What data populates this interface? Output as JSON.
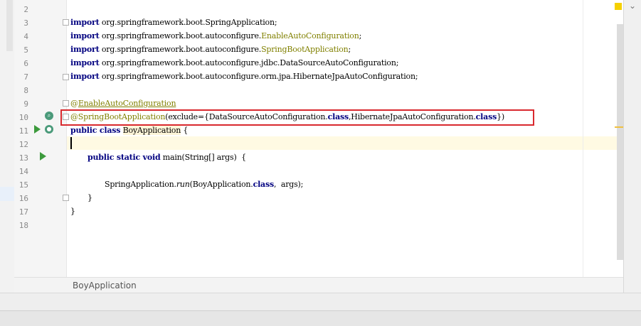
{
  "editor": {
    "line_numbers": [
      "2",
      "3",
      "4",
      "5",
      "6",
      "7",
      "8",
      "9",
      "10",
      "11",
      "12",
      "13",
      "14",
      "15",
      "16",
      "17",
      "18"
    ],
    "code": {
      "l3": [
        "import",
        " org.springframework.boot.SpringApplication;"
      ],
      "l4": [
        "import",
        " org.springframework.boot.autoconfigure.",
        "EnableAutoConfiguration",
        ";"
      ],
      "l5": [
        "import",
        " org.springframework.boot.autoconfigure.",
        "SpringBootApplication",
        ";"
      ],
      "l6": [
        "import",
        " org.springframework.boot.autoconfigure.jdbc.DataSourceAutoConfiguration;"
      ],
      "l7": [
        "import",
        " org.springframework.boot.autoconfigure.orm.jpa.HibernateJpaAutoConfiguration;"
      ],
      "l9": [
        "@",
        "EnableAutoConfiguration"
      ],
      "l10": [
        "@SpringBootApplication",
        "(exclude={DataSourceAutoConfiguration.",
        "class",
        ",HibernateJpaAutoConfiguration.",
        "class",
        "})"
      ],
      "l11": [
        "public class",
        " ",
        "BoyApplication",
        " {"
      ],
      "l13": [
        "public static void",
        " main(String[] args)  {"
      ],
      "l15": [
        "SpringApplication.",
        "run",
        "(BoyApplication.",
        "class",
        ",  args);"
      ],
      "l16": [
        "}"
      ],
      "l17": [
        "}"
      ]
    }
  },
  "status": {
    "breadcrumb": "BoyApplication"
  },
  "colors": {
    "highlight_box": "#d9292e",
    "keyword": "#000080",
    "annotation": "#808000"
  }
}
